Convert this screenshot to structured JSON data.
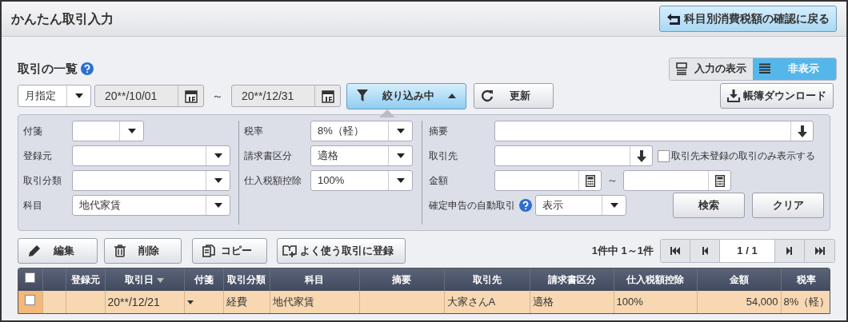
{
  "header": {
    "title": "かんたん取引入力",
    "back_button": "科目別消費税額の確認に戻る"
  },
  "list_title": "取引の一覧",
  "view_toggle": [
    {
      "label": "入力の表示",
      "selected": false
    },
    {
      "label": "非表示",
      "selected": true
    }
  ],
  "period": {
    "mode": "月指定",
    "from": "20**/10/01",
    "separator": "～",
    "to": "20**/12/31"
  },
  "filter_button": {
    "label": "絞り込み中",
    "expanded": true
  },
  "refresh_button": "更新",
  "download_button": "帳簿ダウンロード",
  "filters": {
    "column_1": [
      {
        "label": "付箋"
      },
      {
        "label": "登録元"
      },
      {
        "label": "取引分類"
      },
      {
        "label": "科目",
        "value": "地代家賃"
      }
    ],
    "column_2": [
      {
        "label": "税率",
        "value": "8%（軽）"
      },
      {
        "label": "請求書区分",
        "value": "適格"
      },
      {
        "label": "仕入税額控除",
        "value": "100%"
      }
    ],
    "column_3": [
      {
        "kind": "lookup",
        "label": "摘要"
      },
      {
        "kind": "lookup",
        "label": "取引先",
        "checkbox": {
          "label": "取引先未登録の取引のみ表示する",
          "checked": false
        }
      },
      {
        "kind": "range",
        "label": "金額",
        "separator": "～"
      },
      {
        "kind": "select",
        "label": "確定申告の自動取引",
        "help": true,
        "value": "表示"
      }
    ],
    "buttons": [
      "検索",
      "クリア"
    ]
  },
  "actions": [
    "編集",
    "削除",
    "コピー",
    "よく使う取引に登録"
  ],
  "pagination": {
    "summary": "1件中 1～1件",
    "page": "1 / 1"
  },
  "table": {
    "header_checked": false,
    "columns": [
      {
        "label": "登録元",
        "sorted": false
      },
      {
        "label": "取引日",
        "sorted": true
      },
      {
        "label": "付箋",
        "sorted": false
      },
      {
        "label": "取引分類",
        "sorted": false
      },
      {
        "label": "科目",
        "sorted": false
      },
      {
        "label": "摘要",
        "sorted": false
      },
      {
        "label": "取引先",
        "sorted": false
      },
      {
        "label": "請求書区分",
        "sorted": false
      },
      {
        "label": "仕入税額控除",
        "sorted": false
      },
      {
        "label": "金額",
        "sorted": false
      },
      {
        "label": "税率",
        "sorted": false
      }
    ],
    "rows": [
      {
        "checked": false,
        "selected": true,
        "cells": [
          null,
          "20**/12/21",
          null,
          "経費",
          "地代家賃",
          null,
          "大家さんA",
          "適格",
          "100%",
          "54,000",
          "8%（軽）"
        ]
      }
    ]
  }
}
